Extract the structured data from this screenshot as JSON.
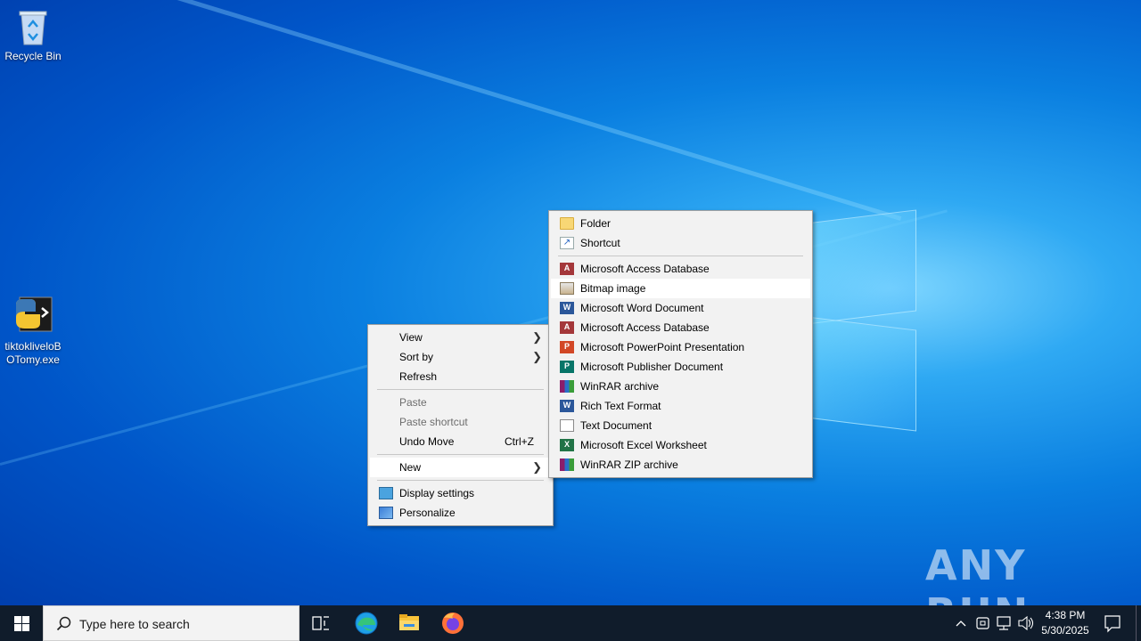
{
  "desktop": {
    "icons": [
      {
        "label": "Recycle Bin",
        "icon": "recycle-bin-icon"
      },
      {
        "label": "tiktokliveloBOTomy.exe",
        "icon": "python-exe-icon"
      }
    ]
  },
  "context_menu": {
    "items": [
      {
        "label": "View",
        "submenu": true
      },
      {
        "label": "Sort by",
        "submenu": true
      },
      {
        "label": "Refresh"
      },
      {
        "label": "Paste",
        "disabled": true
      },
      {
        "label": "Paste shortcut",
        "disabled": true
      },
      {
        "label": "Undo Move",
        "shortcut": "Ctrl+Z"
      },
      {
        "label": "New",
        "submenu": true,
        "highlighted": true
      },
      {
        "label": "Display settings",
        "icon": "display-settings-icon"
      },
      {
        "label": "Personalize",
        "icon": "personalize-icon"
      }
    ]
  },
  "new_submenu": {
    "items": [
      {
        "label": "Folder",
        "icon": "folder-icon"
      },
      {
        "label": "Shortcut",
        "icon": "shortcut-icon"
      },
      {
        "label": "Microsoft Access Database",
        "icon": "access-icon"
      },
      {
        "label": "Bitmap image",
        "icon": "bitmap-icon",
        "highlighted": true
      },
      {
        "label": "Microsoft Word Document",
        "icon": "word-icon"
      },
      {
        "label": "Microsoft Access Database",
        "icon": "access-icon"
      },
      {
        "label": "Microsoft PowerPoint Presentation",
        "icon": "powerpoint-icon"
      },
      {
        "label": "Microsoft Publisher Document",
        "icon": "publisher-icon"
      },
      {
        "label": "WinRAR archive",
        "icon": "winrar-icon"
      },
      {
        "label": "Rich Text Format",
        "icon": "rtf-icon"
      },
      {
        "label": "Text Document",
        "icon": "text-document-icon"
      },
      {
        "label": "Microsoft Excel Worksheet",
        "icon": "excel-icon"
      },
      {
        "label": "WinRAR ZIP archive",
        "icon": "winrar-zip-icon"
      }
    ]
  },
  "taskbar": {
    "search_placeholder": "Type here to search",
    "clock_time": "4:38 PM",
    "clock_date": "5/30/2025"
  },
  "watermark": "ANY RUN",
  "colors": {
    "menu_bg": "#f2f2f2",
    "menu_highlight": "#ffffff",
    "taskbar_bg": "#101c2b",
    "desktop_accent": "#0a7fe0"
  }
}
